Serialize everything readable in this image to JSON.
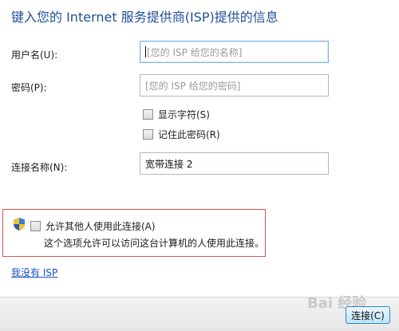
{
  "page_title": "键入您的 Internet 服务提供商(ISP)提供的信息",
  "username": {
    "label": "用户名(U):",
    "placeholder": "[您的 ISP 给您的名称]"
  },
  "password": {
    "label": "密码(P):",
    "placeholder": "[您的 ISP 给您的密码]"
  },
  "show_chars": {
    "label": "显示字符(S)",
    "checked": false
  },
  "remember_pw": {
    "label": "记住此密码(R)",
    "checked": false
  },
  "conn_name": {
    "label": "连接名称(N):",
    "value": "宽带连接 2"
  },
  "allow_others": {
    "label": "允许其他人使用此连接(A)",
    "checked": false,
    "description": "这个选项允许可以访问这台计算机的人使用此连接。"
  },
  "no_isp_link": "我没有 ISP",
  "connect_button": "连接(C)",
  "watermark": "Bai 经验",
  "colors": {
    "title": "#1f4f99",
    "link": "#1a4fbf",
    "highlight_border": "#d9534f"
  },
  "icons": {
    "uac": "uac-shield-icon"
  }
}
